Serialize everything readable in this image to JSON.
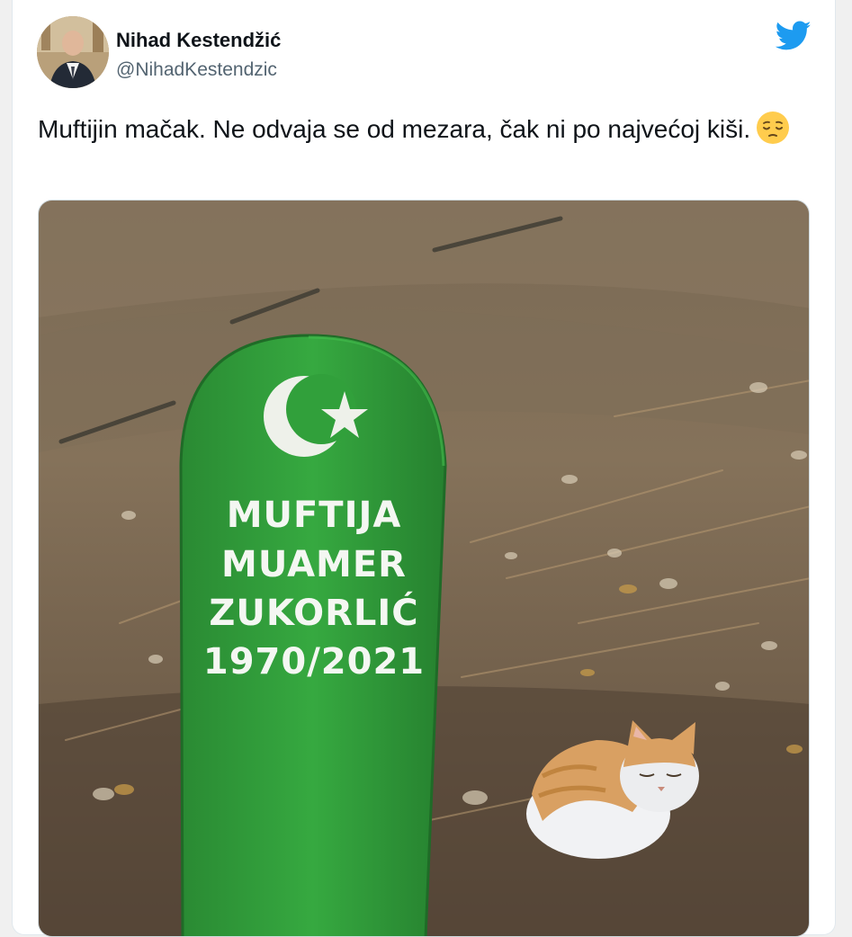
{
  "tweet": {
    "author_name": "Nihad Kestendžić",
    "author_handle": "@NihadKestendzic",
    "text": "Muftijin mačak. Ne odvaja se od mezara, čak ni po najvećoj kiši.",
    "emoji": "pensive-face-emoji",
    "brand_icon": "twitter-bird-icon",
    "brand_color": "#1d9bf0"
  },
  "photo": {
    "gravestone_lines": [
      "MUFTIJA",
      "MUAMER",
      "ZUKORLIĆ",
      "1970/2021"
    ],
    "gravestone_color": "#2f9b3a",
    "symbols": [
      "crescent-icon",
      "star-icon"
    ]
  }
}
